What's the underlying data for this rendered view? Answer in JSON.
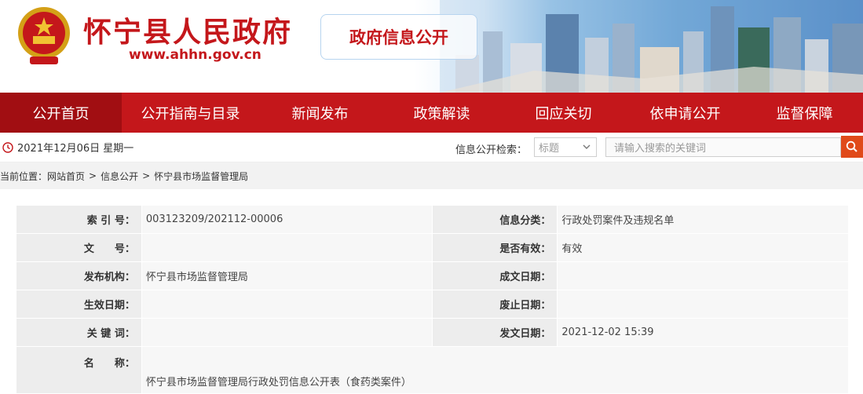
{
  "header": {
    "site_title": "怀宁县人民政府",
    "site_url": "www.ahhn.gov.cn",
    "section_badge": "政府信息公开"
  },
  "nav": {
    "items": [
      {
        "label": "公开首页",
        "active": true
      },
      {
        "label": "公开指南与目录"
      },
      {
        "label": "新闻发布"
      },
      {
        "label": "政策解读"
      },
      {
        "label": "回应关切"
      },
      {
        "label": "依申请公开"
      },
      {
        "label": "监督保障"
      }
    ]
  },
  "infobar": {
    "date": "2021年12月06日 星期一",
    "search_label": "信息公开检索：",
    "select_value": "标题",
    "search_placeholder": "请输入搜索的关键词"
  },
  "breadcrumb": {
    "prefix": "当前位置：",
    "items": [
      "网站首页",
      "信息公开",
      "怀宁县市场监督管理局"
    ],
    "sep": ">"
  },
  "meta": {
    "index_label": "索 引 号：",
    "index_value": "003123209/202112-00006",
    "category_label": "信息分类：",
    "category_value": "行政处罚案件及违规名单",
    "doc_no_label": "文　　号：",
    "doc_no_value": "",
    "valid_label": "是否有效：",
    "valid_value": "有效",
    "publisher_label": "发布机构：",
    "publisher_value": "怀宁县市场监督管理局",
    "written_label": "成文日期：",
    "written_value": "",
    "effective_label": "生效日期：",
    "effective_value": "",
    "abolish_label": "废止日期：",
    "abolish_value": "",
    "keywords_label": "关 键 词：",
    "keywords_value": "",
    "issued_label": "发文日期：",
    "issued_value": "2021-12-02 15:39",
    "name_label": "名　　称：",
    "name_value": "怀宁县市场监督管理局行政处罚信息公开表（食药类案件）"
  },
  "colors": {
    "brand_red": "#c4171b",
    "nav_active": "#a10e12",
    "search_button": "#e04a1a"
  },
  "icons": {
    "emblem": "national-emblem-icon",
    "clock": "clock-icon",
    "chevron": "chevron-down-icon",
    "search": "search-icon"
  }
}
